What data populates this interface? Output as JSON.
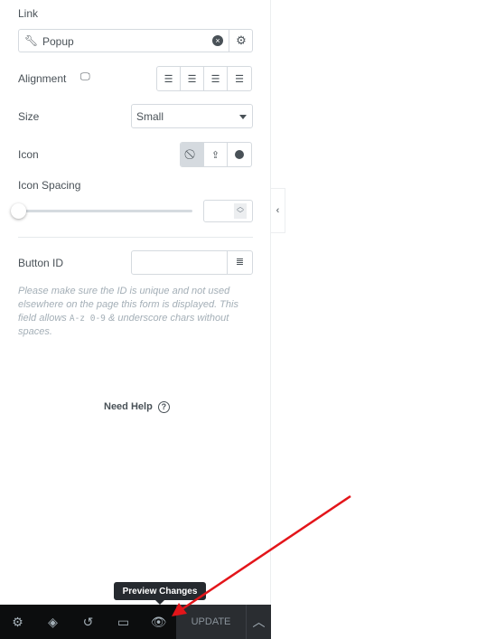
{
  "link": {
    "label": "Link",
    "value": "Popup",
    "icon": "wrench-icon"
  },
  "alignment": {
    "label": "Alignment",
    "options": [
      "align-left",
      "align-center",
      "align-right",
      "align-justify"
    ]
  },
  "size": {
    "label": "Size",
    "value": "Small"
  },
  "icon": {
    "label": "Icon",
    "options": [
      "none",
      "upload",
      "circle"
    ],
    "selected": "none"
  },
  "icon_spacing": {
    "label": "Icon Spacing",
    "value": ""
  },
  "button_id": {
    "label": "Button ID",
    "value": "",
    "help_pre": "Please make sure the ID is unique and not used elsewhere on the page this form is displayed. This field allows ",
    "help_code": "A-z 0-9",
    "help_post": " & underscore chars without spaces."
  },
  "need_help": "Need Help",
  "toolbar": {
    "tooltip": "Preview Changes",
    "update": "UPDATE"
  },
  "colors": {
    "toolbar_bg": "#0c0d0e",
    "arrow": "#e3151a"
  }
}
